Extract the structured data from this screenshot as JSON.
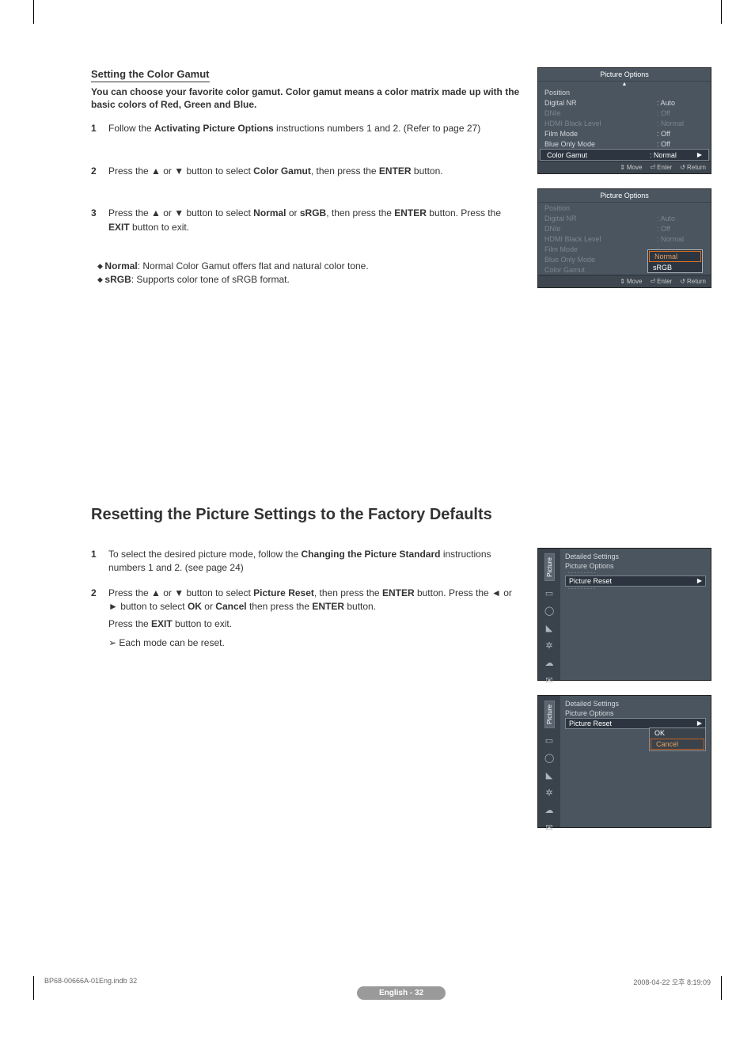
{
  "section1": {
    "title": "Setting the Color Gamut",
    "intro": "You can choose your favorite color gamut. Color gamut means a color matrix made up with the basic colors of Red, Green and Blue.",
    "steps": [
      {
        "n": "1",
        "html": "Follow the <b>Activating Picture Options</b> instructions numbers 1 and 2. (Refer to page 27)"
      },
      {
        "n": "2",
        "html": "Press the ▲ or ▼ button to select <b>Color Gamut</b>, then press the <b>ENTER</b> button."
      },
      {
        "n": "3",
        "html": "Press the ▲ or ▼ button to select <b>Normal</b> or <b>sRGB</b>, then press the <b>ENTER</b> button. Press the <b>EXIT</b> button to exit."
      }
    ],
    "notes": [
      {
        "html": "<b>Normal</b>: Normal Color Gamut offers flat and natural color tone."
      },
      {
        "html": "<b>sRGB</b>: Supports color tone of sRGB format."
      }
    ]
  },
  "section2": {
    "title": "Resetting the Picture Settings to the Factory Defaults",
    "steps": [
      {
        "n": "1",
        "html": "To select the desired picture mode, follow the <b>Changing the Picture Standard</b> instructions numbers 1 and 2. (see page 24)"
      },
      {
        "n": "2",
        "html": "Press the ▲ or ▼ button to select <b>Picture Reset</b>, then press the <b>ENTER</b> button. Press the ◄ or ► button to select <b>OK</b> or <b>Cancel</b> then press the <b>ENTER</b> button."
      }
    ],
    "exitline": "Press the <b>EXIT</b> button to exit.",
    "pointer": "Each mode can be reset."
  },
  "tv1": {
    "header": "Picture Options",
    "rows": [
      {
        "lbl": "Position",
        "val": "",
        "dim": false
      },
      {
        "lbl": "Digital NR",
        "val": ": Auto",
        "dim": false
      },
      {
        "lbl": "DNIe",
        "val": ": Off",
        "dim": true
      },
      {
        "lbl": "HDMI Black Level",
        "val": ": Normal",
        "dim": true
      },
      {
        "lbl": "Film Mode",
        "val": ": Off",
        "dim": false
      },
      {
        "lbl": "Blue Only Mode",
        "val": ": Off",
        "dim": false
      }
    ],
    "sel": {
      "lbl": "Color Gamut",
      "val": ": Normal"
    },
    "footer": {
      "move": "Move",
      "enter": "Enter",
      "return": "Return"
    }
  },
  "tv2": {
    "header": "Picture Options",
    "rows": [
      {
        "lbl": "Position",
        "val": ""
      },
      {
        "lbl": "Digital NR",
        "val": ": Auto"
      },
      {
        "lbl": "DNIe",
        "val": ": Off"
      },
      {
        "lbl": "HDMI Black Level",
        "val": ": Normal"
      },
      {
        "lbl": "Film Mode",
        "val": ":"
      },
      {
        "lbl": "Blue Only Mode",
        "val": ":"
      },
      {
        "lbl": "Color Gamut",
        "val": ":"
      }
    ],
    "popup": [
      "Normal",
      "sRGB"
    ],
    "footer": {
      "move": "Move",
      "enter": "Enter",
      "return": "Return"
    }
  },
  "pr_common": {
    "tab": "Picture",
    "lines": [
      "Detailed Settings",
      "Picture Options"
    ],
    "sel": "Picture Reset",
    "popup": [
      "OK",
      "Cancel"
    ]
  },
  "pagefoot": "English - 32",
  "meta": {
    "left": "BP68-00666A-01Eng.indb   32",
    "right": "2008-04-22   오후 8:19:09"
  }
}
